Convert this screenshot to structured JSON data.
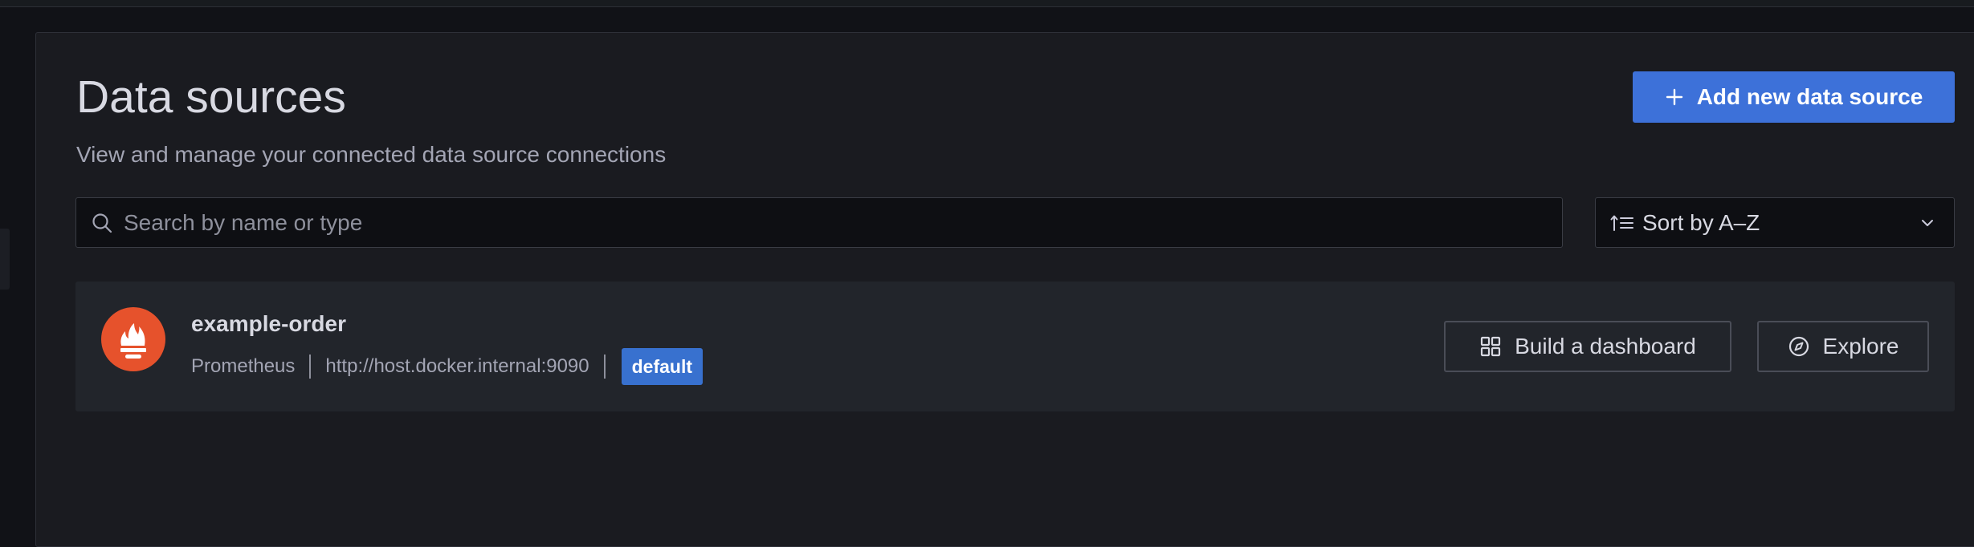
{
  "header": {
    "title": "Data sources",
    "subtitle": "View and manage your connected data source connections",
    "add_button_label": "Add new data source"
  },
  "filters": {
    "search_placeholder": "Search by name or type",
    "search_value": "",
    "sort_label": "Sort by A–Z"
  },
  "datasources": [
    {
      "name": "example-order",
      "type": "Prometheus",
      "url": "http://host.docker.internal:9090",
      "badge": "default",
      "logo_color": "#e6522c",
      "build_dashboard_label": "Build a dashboard",
      "explore_label": "Explore"
    }
  ],
  "colors": {
    "primary": "#3d71d9",
    "badge": "#3871cf",
    "prometheus": "#e6522c"
  },
  "icons": {
    "add": "plus-icon",
    "search": "search-icon",
    "sort": "sort-ascending-icon",
    "dropdown": "chevron-down-icon",
    "dashboard": "apps-grid-icon",
    "explore": "compass-icon",
    "datasource_logo": "prometheus-logo-icon"
  }
}
